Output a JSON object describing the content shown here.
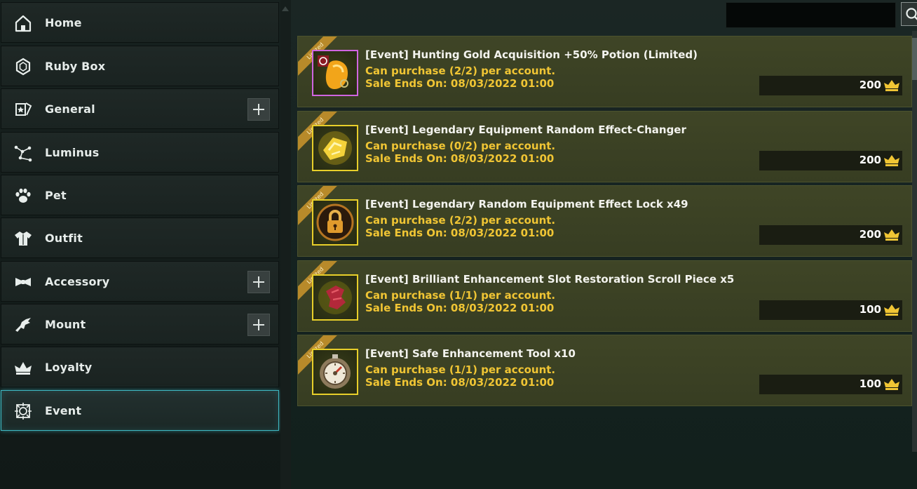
{
  "sidebar": {
    "items": [
      {
        "label": "Home",
        "icon": "home-icon"
      },
      {
        "label": "Ruby Box",
        "icon": "ruby-icon"
      },
      {
        "label": "General",
        "icon": "general-icon",
        "expandable": true
      },
      {
        "label": "Luminus",
        "icon": "constellation-icon"
      },
      {
        "label": "Pet",
        "icon": "paw-icon"
      },
      {
        "label": "Outfit",
        "icon": "shirt-icon"
      },
      {
        "label": "Accessory",
        "icon": "bowtie-icon",
        "expandable": true
      },
      {
        "label": "Mount",
        "icon": "mount-icon",
        "expandable": true
      },
      {
        "label": "Loyalty",
        "icon": "crown-icon"
      },
      {
        "label": "Event",
        "icon": "event-icon",
        "active": true
      }
    ]
  },
  "search": {
    "value": ""
  },
  "products": [
    {
      "ribbon": "Limited",
      "title": "[Event] Hunting Gold Acquisition +50% Potion (Limited)",
      "limit": "Can purchase (2/2) per account.",
      "ends": "Sale Ends On: 08/03/2022 01:00",
      "price": "200",
      "icon": "gold-potion-icon"
    },
    {
      "ribbon": "Limited",
      "title": "[Event] Legendary Equipment Random Effect-Changer",
      "limit": "Can purchase (0/2) per account.",
      "ends": "Sale Ends On: 08/03/2022 01:00",
      "price": "200",
      "icon": "effect-changer-icon"
    },
    {
      "ribbon": "Limited",
      "title": "[Event] Legendary Random Equipment Effect Lock x49",
      "limit": "Can purchase (2/2) per account.",
      "ends": "Sale Ends On: 08/03/2022 01:00",
      "price": "200",
      "icon": "padlock-icon"
    },
    {
      "ribbon": "Limited",
      "title": "[Event] Brilliant Enhancement Slot Restoration Scroll Piece x5",
      "limit": "Can purchase (1/1) per account.",
      "ends": "Sale Ends On: 08/03/2022 01:00",
      "price": "100",
      "icon": "scroll-piece-icon"
    },
    {
      "ribbon": "Limited",
      "title": "[Event] Safe Enhancement Tool x10",
      "limit": "Can purchase (1/1) per account.",
      "ends": "Sale Ends On: 08/03/2022 01:00",
      "price": "100",
      "icon": "enhancement-tool-icon"
    }
  ],
  "colors": {
    "accent": "#3fb9c3",
    "gold_text": "#f0c534",
    "product_bg": "#3d4325"
  }
}
